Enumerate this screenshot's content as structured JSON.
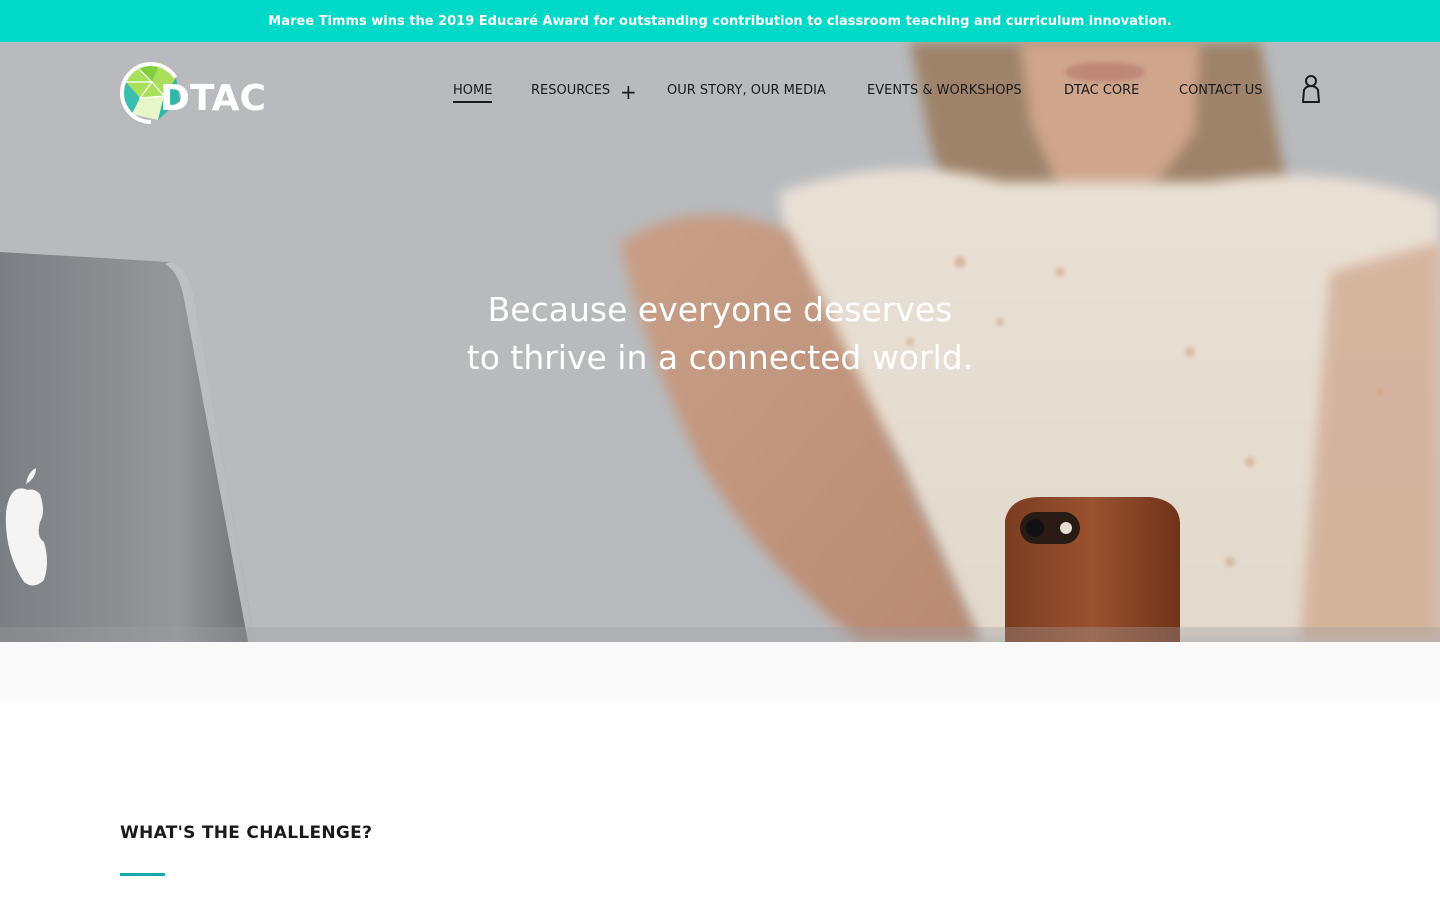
{
  "announcement": "Maree Timms wins the 2019 Educaré Award for outstanding contribution to classroom teaching and curriculum innovation.",
  "brand": {
    "name": "DTAC"
  },
  "nav": {
    "items": [
      {
        "label": "HOME",
        "active": true
      },
      {
        "label": "RESOURCES",
        "has_submenu": true
      },
      {
        "label": "OUR STORY, OUR MEDIA"
      },
      {
        "label": "EVENTS & WORKSHOPS"
      },
      {
        "label": "DTAC CORE"
      },
      {
        "label": "CONTACT US"
      }
    ],
    "account_icon": "user-icon",
    "submenu_icon": "plus-icon"
  },
  "hero": {
    "line1": "Because everyone deserves",
    "line2": "to thrive in a connected world."
  },
  "section": {
    "title": "WHAT'S THE CHALLENGE?"
  },
  "colors": {
    "announcement_bg": "#00d8c8",
    "accent_rule": "#17a9a9",
    "logo_green": "#8fd14f",
    "logo_teal": "#2fb8a8"
  }
}
